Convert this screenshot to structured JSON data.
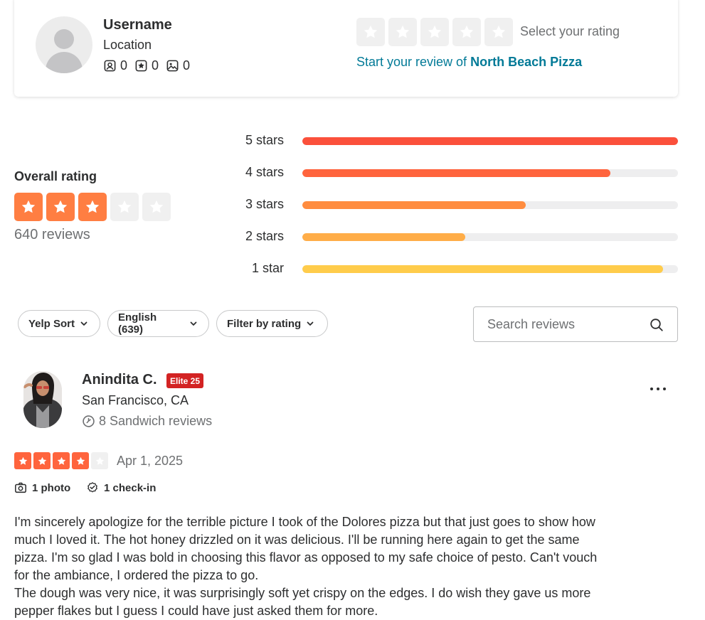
{
  "prompt_card": {
    "username": "Username",
    "location": "Location",
    "stats": [
      {
        "icon": "friends-icon",
        "value": "0"
      },
      {
        "icon": "reviews-star-icon",
        "value": "0"
      },
      {
        "icon": "photos-icon",
        "value": "0"
      }
    ],
    "select_rating_label": "Select your rating",
    "start_review_prefix": "Start your review of",
    "business_name": "North Beach Pizza"
  },
  "overall": {
    "label": "Overall rating",
    "stars": 3,
    "max_stars": 5,
    "review_count": "640 reviews",
    "distribution": [
      {
        "label": "5 stars",
        "fraction": 1.0,
        "color": "#fb503b"
      },
      {
        "label": "4 stars",
        "fraction": 0.82,
        "color": "#ff643d"
      },
      {
        "label": "3 stars",
        "fraction": 0.595,
        "color": "#ff8c3f"
      },
      {
        "label": "2 stars",
        "fraction": 0.434,
        "color": "#ffad48"
      },
      {
        "label": "1 star",
        "fraction": 0.961,
        "color": "#ffcc4b"
      }
    ]
  },
  "filters": {
    "sort_label": "Yelp Sort",
    "language_label": "English (639)",
    "rating_filter_label": "Filter by rating",
    "search_placeholder": "Search reviews"
  },
  "review": {
    "author": "Anindita C.",
    "elite_badge": "Elite 25",
    "location": "San Francisco, CA",
    "reviews_stat": "8 Sandwich reviews",
    "stars": 4,
    "max_stars": 5,
    "date": "Apr 1, 2025",
    "photos": "1 photo",
    "checkins": "1 check-in",
    "text_lines": [
      "I'm sincerely apologize for the terrible picture I took of the Dolores pizza but that just goes to show how much I loved it. The hot honey drizzled on it was delicious. I'll be running here again to get the same pizza. I'm so glad I was bold in choosing this flavor as opposed to my safe choice of pesto. Can't vouch for the ambiance, I ordered the pizza to go.",
      "The dough was very nice, it was surprisingly soft yet crispy on the edges. I do wish they gave us more pepper flakes but I guess I could have just asked them for more."
    ]
  },
  "colors": {
    "brand_red": "#d32323",
    "star_orange": "#ff643d",
    "star_overall": "#ff7e42",
    "link_teal": "#027a97",
    "empty_star_bg": "#f0f0f0"
  }
}
